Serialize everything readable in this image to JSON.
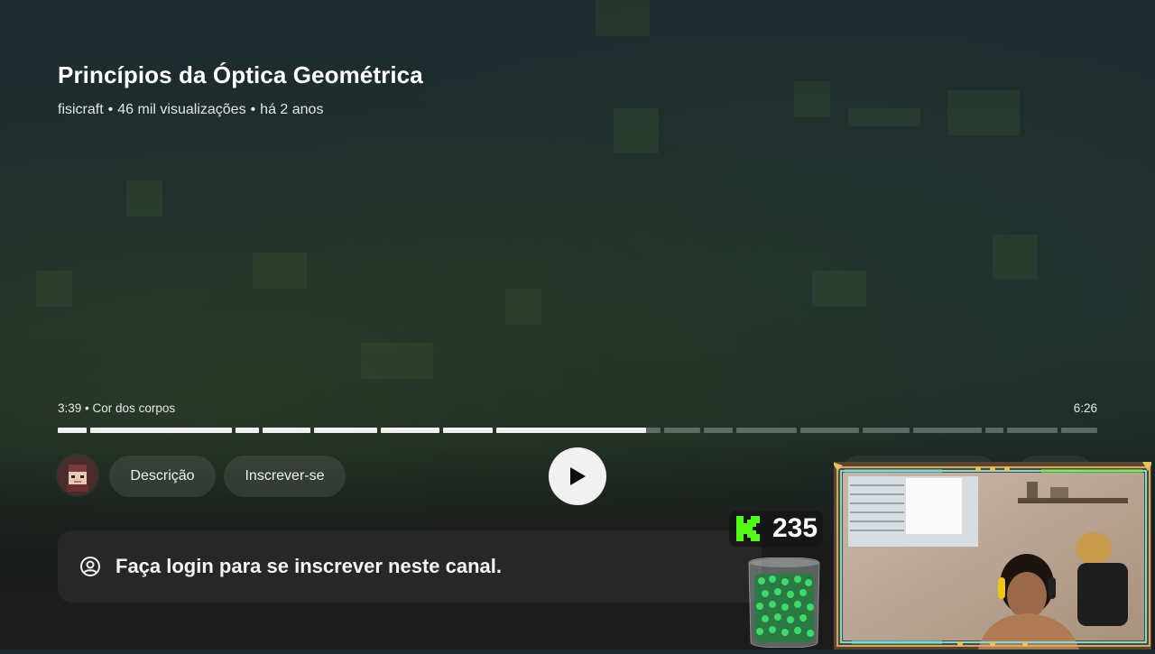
{
  "video": {
    "title": "Princípios da Óptica Geométrica",
    "channel": "fisicraft",
    "views": "46 mil visualizações",
    "age": "há 2 anos",
    "separator": "•"
  },
  "player": {
    "current_time": "3:39",
    "chapter": "Cor dos corpos",
    "duration": "6:26",
    "progress_fraction": 0.566
  },
  "actions": {
    "description_label": "Descrição",
    "subscribe_label": "Inscrever-se",
    "play_icon": "play-icon"
  },
  "login_prompt": {
    "text": "Faça login para se inscrever neste canal.",
    "icon": "account-circle-icon"
  },
  "overlay": {
    "kick_count": "235",
    "kick_color": "#53fc18"
  },
  "colors": {
    "progress_fill": "#f1f1f1",
    "chip_bg": "rgba(255,255,255,0.09)"
  }
}
